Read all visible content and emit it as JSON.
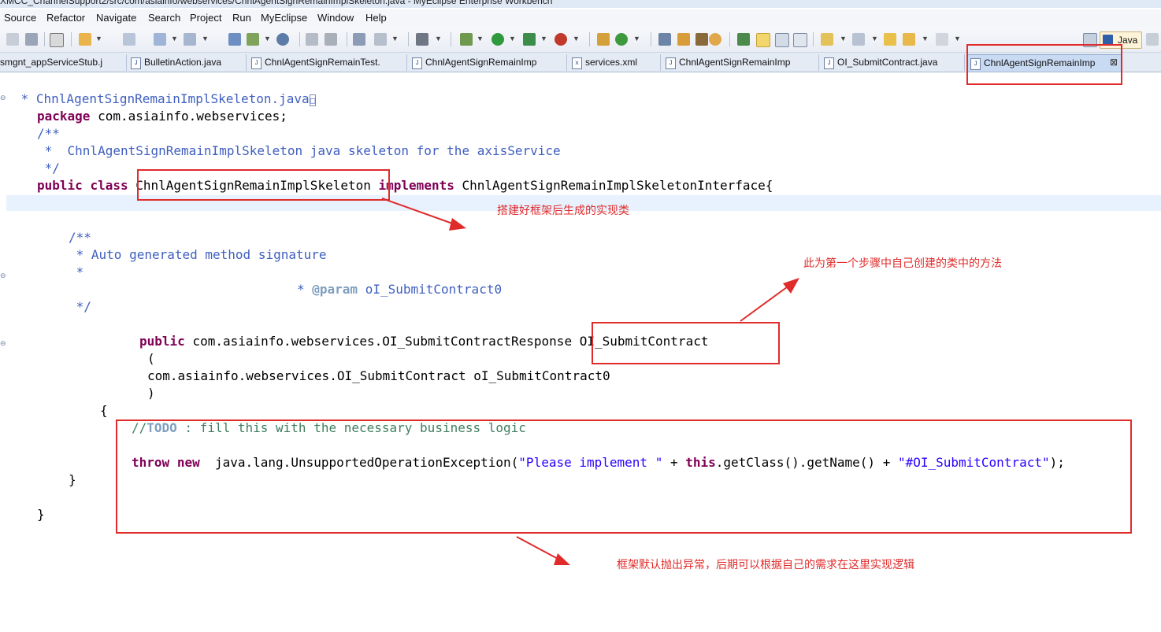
{
  "window": {
    "title": "XMCC_ChannelSupport2/src/com/asiainfo/webservices/ChnlAgentSignRemainImplSkeleton.java - MyEclipse Enterprise Workbench"
  },
  "menu": [
    "Source",
    "Refactor",
    "Navigate",
    "Search",
    "Project",
    "Run",
    "MyEclipse",
    "Window",
    "Help"
  ],
  "perspective": {
    "label": "Java"
  },
  "tabs": [
    {
      "label": "smgnt_appServiceStub.j",
      "icon": "J"
    },
    {
      "label": "BulletinAction.java",
      "icon": "J"
    },
    {
      "label": "ChnlAgentSignRemainTest.",
      "icon": "J"
    },
    {
      "label": "ChnlAgentSignRemainImp",
      "icon": "J"
    },
    {
      "label": "services.xml",
      "icon": "x"
    },
    {
      "label": "ChnlAgentSignRemainImp",
      "icon": "J"
    },
    {
      "label": "OI_SubmitContract.java",
      "icon": "J"
    },
    {
      "label": "ChnlAgentSignRemainImp",
      "icon": "J",
      "active": true,
      "close": "⊠"
    }
  ],
  "code": {
    "l1": " * ChnlAgentSignRemainImplSkeleton.java",
    "l1_fold": "□",
    "package_kw": "package",
    "package_rest": " com.asiainfo.webservices;",
    "l3": "/**",
    "l4": " *  ChnlAgentSignRemainImplSkeleton java skeleton for the axisService",
    "l5": " */",
    "l6_kw1": "public",
    "l6_kw2": "class",
    "l6_class": "ChnlAgentSignRemainImplSkeleton",
    "l6_kw3": "implements",
    "l6_rest": "ChnlAgentSignRemainImplSkeletonInterface{",
    "l8": "/**",
    "l9": " * Auto generated method signature",
    "l10": " *",
    "l11_star": "* ",
    "l11_tag": "@param",
    "l11_rest": " oI_SubmitContract0",
    "l12": " */",
    "l13_kw": "public",
    "l13_rest": " com.asiainfo.webservices.OI_SubmitContractResponse ",
    "l13_method": "OI_SubmitContract",
    "l14": "(",
    "l15": "com.asiainfo.webservices.OI_SubmitContract oI_SubmitContract0",
    "l16": ")",
    "l17": "{",
    "l18_slash": "//",
    "l18_todo": "TODO",
    "l18_rest": " : fill this with the necessary business logic",
    "l19_kw1": "throw",
    "l19_kw2": "new",
    "l19_a": "  java.lang.UnsupportedOperationException(",
    "l19_str1": "\"Please implement \"",
    "l19_b": " + ",
    "l19_kw3": "this",
    "l19_c": ".getClass().getName() + ",
    "l19_str2": "\"#OI_SubmitContract\"",
    "l19_d": ");",
    "l20": "}",
    "l21": "}"
  },
  "annotations": {
    "class_note": "搭建好框架后生成的实现类",
    "method_note": "此为第一个步骤中自己创建的类中的方法",
    "exception_note": "框架默认抛出异常，后期可以根据自己的需求在这里实现逻辑"
  },
  "colors": {
    "annotation": "#e02b2b",
    "keyword": "#7f0055",
    "javadoc": "#3f5fbf",
    "comment": "#3f7f5f",
    "string": "#2a00ff"
  }
}
